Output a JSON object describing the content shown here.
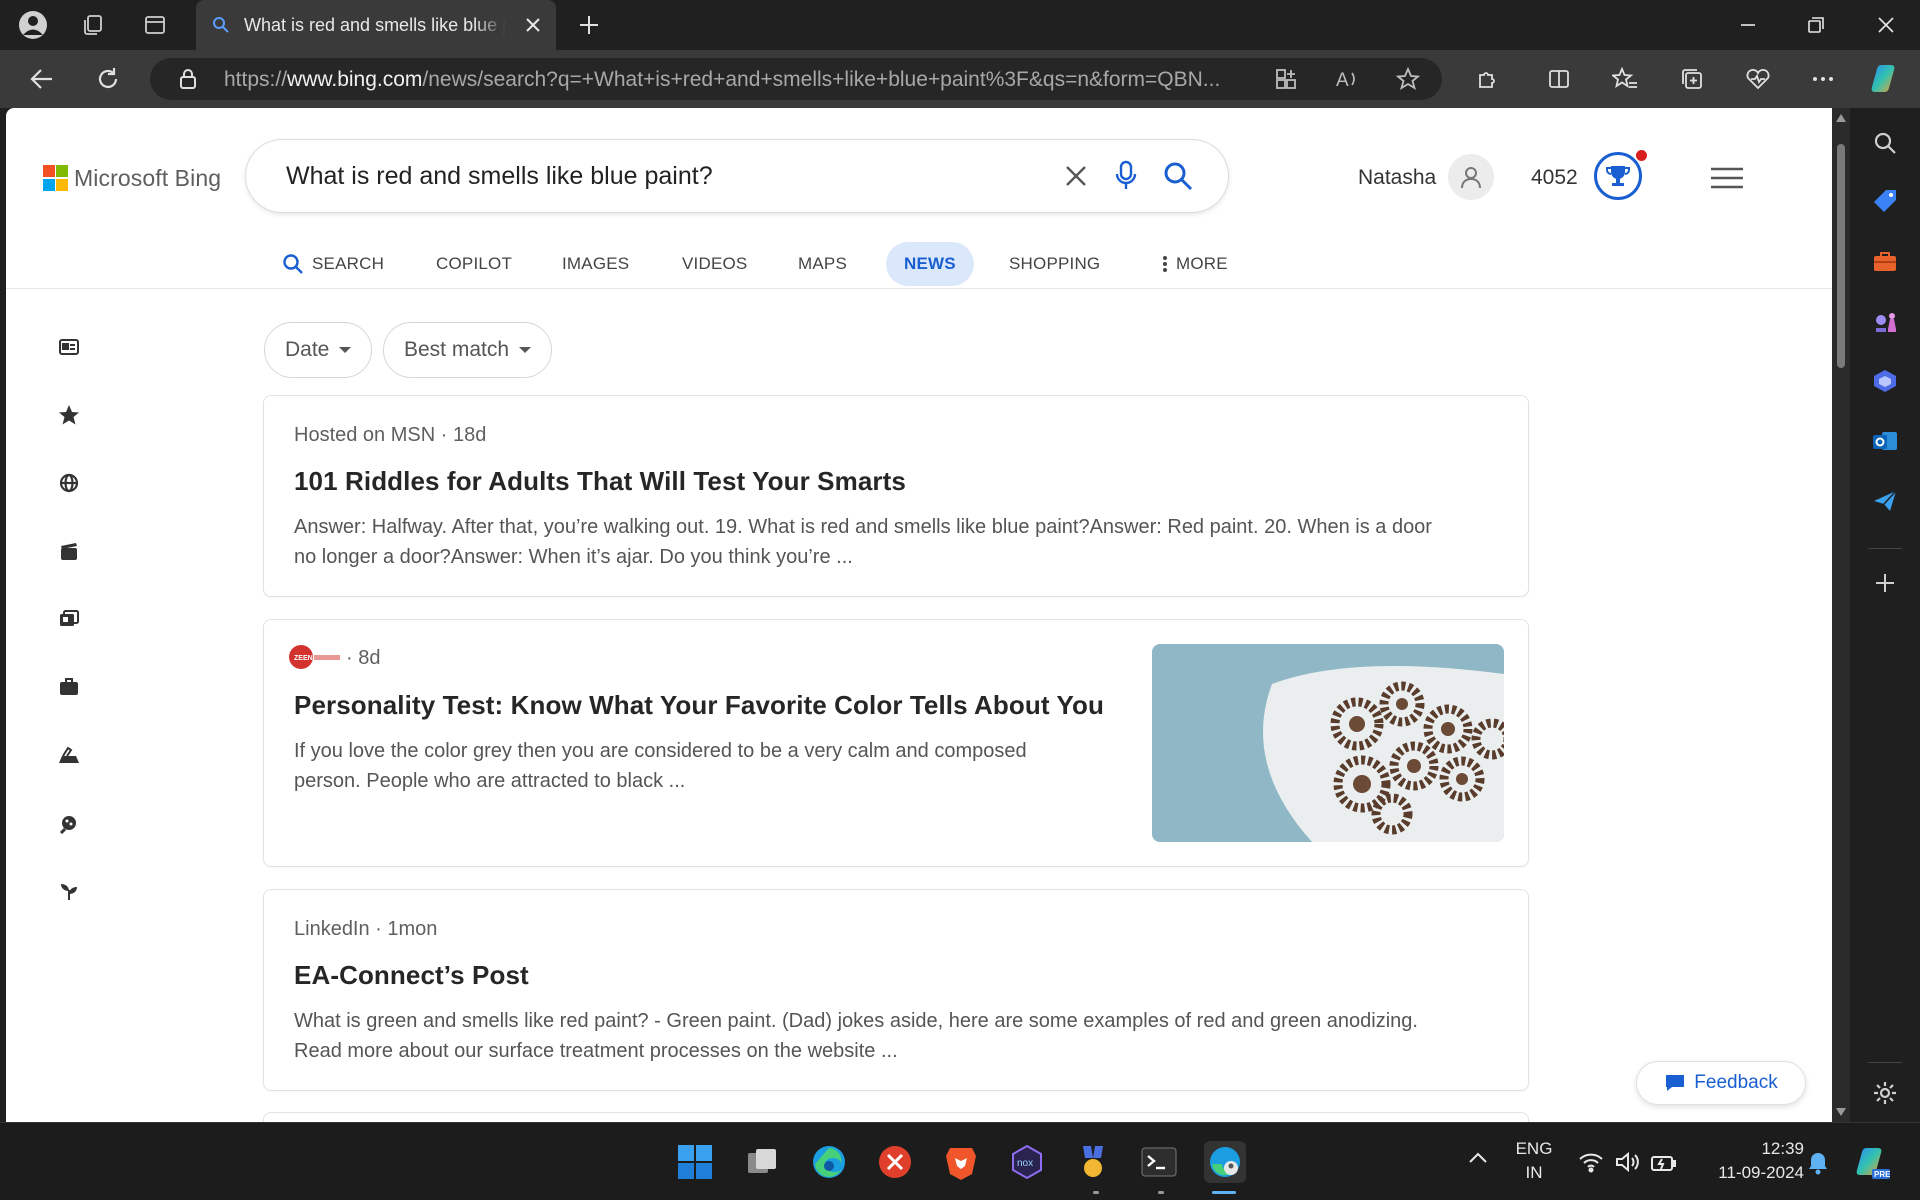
{
  "browser": {
    "tab_title": "What is red and smells like blue paint?",
    "url_prefix": "https://",
    "url_host": "www.bing.com",
    "url_rest": "/news/search?q=+What+is+red+and+smells+like+blue+paint%3F&qs=n&form=QBN..."
  },
  "bing": {
    "logo_text": "Microsoft Bing",
    "search_query": "What is red and smells like blue paint?",
    "user_name": "Natasha",
    "reward_points": "4052",
    "scopes": [
      {
        "label": "SEARCH"
      },
      {
        "label": "COPILOT"
      },
      {
        "label": "IMAGES"
      },
      {
        "label": "VIDEOS"
      },
      {
        "label": "MAPS"
      },
      {
        "label": "NEWS",
        "active": true
      },
      {
        "label": "SHOPPING"
      },
      {
        "label": "MORE"
      }
    ],
    "filters": {
      "date": "Date",
      "sort": "Best match"
    },
    "results": [
      {
        "source": "Hosted on MSN · 18d",
        "title": "101 Riddles for Adults That Will Test Your Smarts",
        "snippet_line1": "Answer: Halfway. After that, you’re walking out. 19. What is red and smells like blue paint?Answer: Red paint. 20. When is a door",
        "snippet_line2": "no longer a door?Answer: When it’s ajar. Do you think you’re ..."
      },
      {
        "source_logo": "ZEENEWS",
        "source": "· 8d",
        "title": "Personality Test: Know What Your Favorite Color Tells About You",
        "snippet_line1": "If you love the color grey then you are considered to be a very calm and composed",
        "snippet_line2": "person. People who are attracted to black ..."
      },
      {
        "source": "LinkedIn · 1mon",
        "title": "EA-Connect’s Post",
        "snippet_line1": "What is green and smells like red paint? - Green paint. (Dad) jokes aside, here are some examples of red and green anodizing.",
        "snippet_line2": "Read more about our surface treatment processes on the website ..."
      }
    ],
    "feedback_label": "Feedback"
  },
  "taskbar": {
    "lang_line1": "ENG",
    "lang_line2": "IN",
    "time": "12:39",
    "date": "11-09-2024"
  },
  "colors": {
    "accent": "#1a5fd1",
    "active_scope_bg": "#dbe8fb"
  }
}
